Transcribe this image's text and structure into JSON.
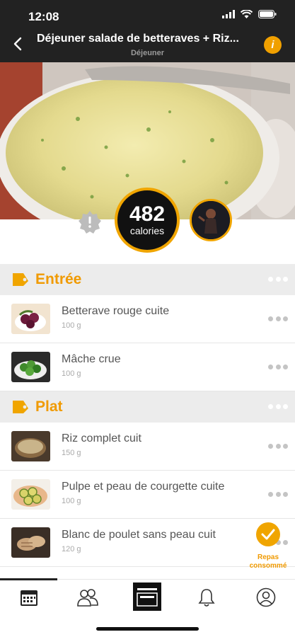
{
  "status_bar": {
    "time": "12:08"
  },
  "nav": {
    "title": "Déjeuner salade de betteraves + Riz...",
    "subtitle": "Déjeuner",
    "info_label": "i"
  },
  "summary": {
    "calories_value": "482",
    "calories_unit": "calories"
  },
  "sections": [
    {
      "title": "Entrée",
      "items": [
        {
          "name": "Betterave rouge cuite",
          "qty": "100 g",
          "icon": "beetroot-thumbnail"
        },
        {
          "name": "Mâche crue",
          "qty": "100 g",
          "icon": "lambs-lettuce-thumbnail"
        }
      ]
    },
    {
      "title": "Plat",
      "items": [
        {
          "name": "Riz complet cuit",
          "qty": "150 g",
          "icon": "brown-rice-thumbnail"
        },
        {
          "name": "Pulpe et peau de courgette cuite",
          "qty": "100 g",
          "icon": "zucchini-thumbnail"
        },
        {
          "name": "Blanc de poulet sans peau cuit",
          "qty": "120 g",
          "icon": "chicken-breast-thumbnail"
        }
      ]
    }
  ],
  "consumed": {
    "label_line1": "Repas",
    "label_line2": "consommé"
  },
  "tabs": [
    "calendar-icon",
    "community-icon",
    "oven-icon",
    "bell-icon",
    "profile-icon"
  ],
  "colors": {
    "accent": "#f0a500",
    "header_bg": "#222222",
    "section_bg": "#ececec"
  }
}
